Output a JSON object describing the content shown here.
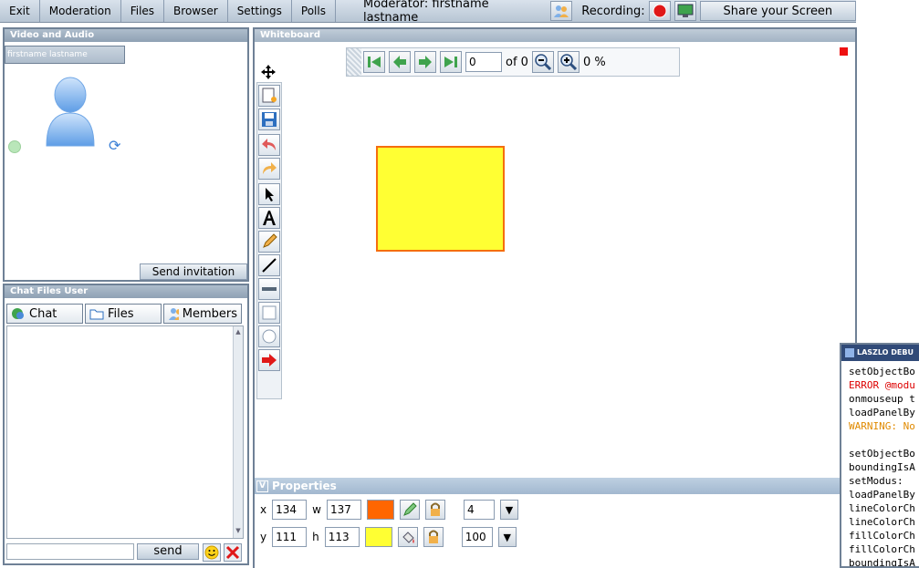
{
  "menu": {
    "exit": "Exit",
    "moderation": "Moderation",
    "files": "Files",
    "browser": "Browser",
    "settings": "Settings",
    "polls": "Polls",
    "moderator": "Moderator: firstname lastname",
    "recording": "Recording:",
    "share": "Share your Screen"
  },
  "video": {
    "title": "Video and Audio",
    "username": "firstname lastname",
    "send_invitation": "Send invitation"
  },
  "chat": {
    "title": "Chat Files User",
    "tabs": [
      "Chat",
      "Files",
      "Members"
    ],
    "send": "send",
    "input_value": ""
  },
  "whiteboard": {
    "title": "Whiteboard",
    "page": "0",
    "of_label": "of 0",
    "zoom": "0 %",
    "shape_fill": "#ffff33",
    "shape_line": "#f56e0e"
  },
  "properties": {
    "title": "Properties",
    "x_label": "x",
    "x": "134",
    "w_label": "w",
    "w": "137",
    "y_label": "y",
    "y": "111",
    "h_label": "h",
    "h": "113",
    "line_color": "#ff6600",
    "fill_color": "#ffff33",
    "line_width": "4",
    "opacity": "100"
  },
  "debugger": {
    "title": "LASZLO DEBU",
    "lines": [
      {
        "text": "setObjectBo",
        "color": "#000000"
      },
      {
        "text": "ERROR @modu",
        "color": "#dd0000"
      },
      {
        "text": "onmouseup t",
        "color": "#000000"
      },
      {
        "text": "loadPanelBy",
        "color": "#000000"
      },
      {
        "text": "WARNING: No",
        "color": "#e08a00"
      },
      {
        "text": "",
        "color": "#000000"
      },
      {
        "text": "setObjectBo",
        "color": "#000000"
      },
      {
        "text": "boundingIsA",
        "color": "#000000"
      },
      {
        "text": "setModus:",
        "color": "#000000"
      },
      {
        "text": "loadPanelBy",
        "color": "#000000"
      },
      {
        "text": "lineColorCh",
        "color": "#000000"
      },
      {
        "text": "lineColorCh",
        "color": "#000000"
      },
      {
        "text": "fillColorCh",
        "color": "#000000"
      },
      {
        "text": "fillColorCh",
        "color": "#000000"
      },
      {
        "text": "boundingIsA",
        "color": "#000000"
      }
    ]
  }
}
